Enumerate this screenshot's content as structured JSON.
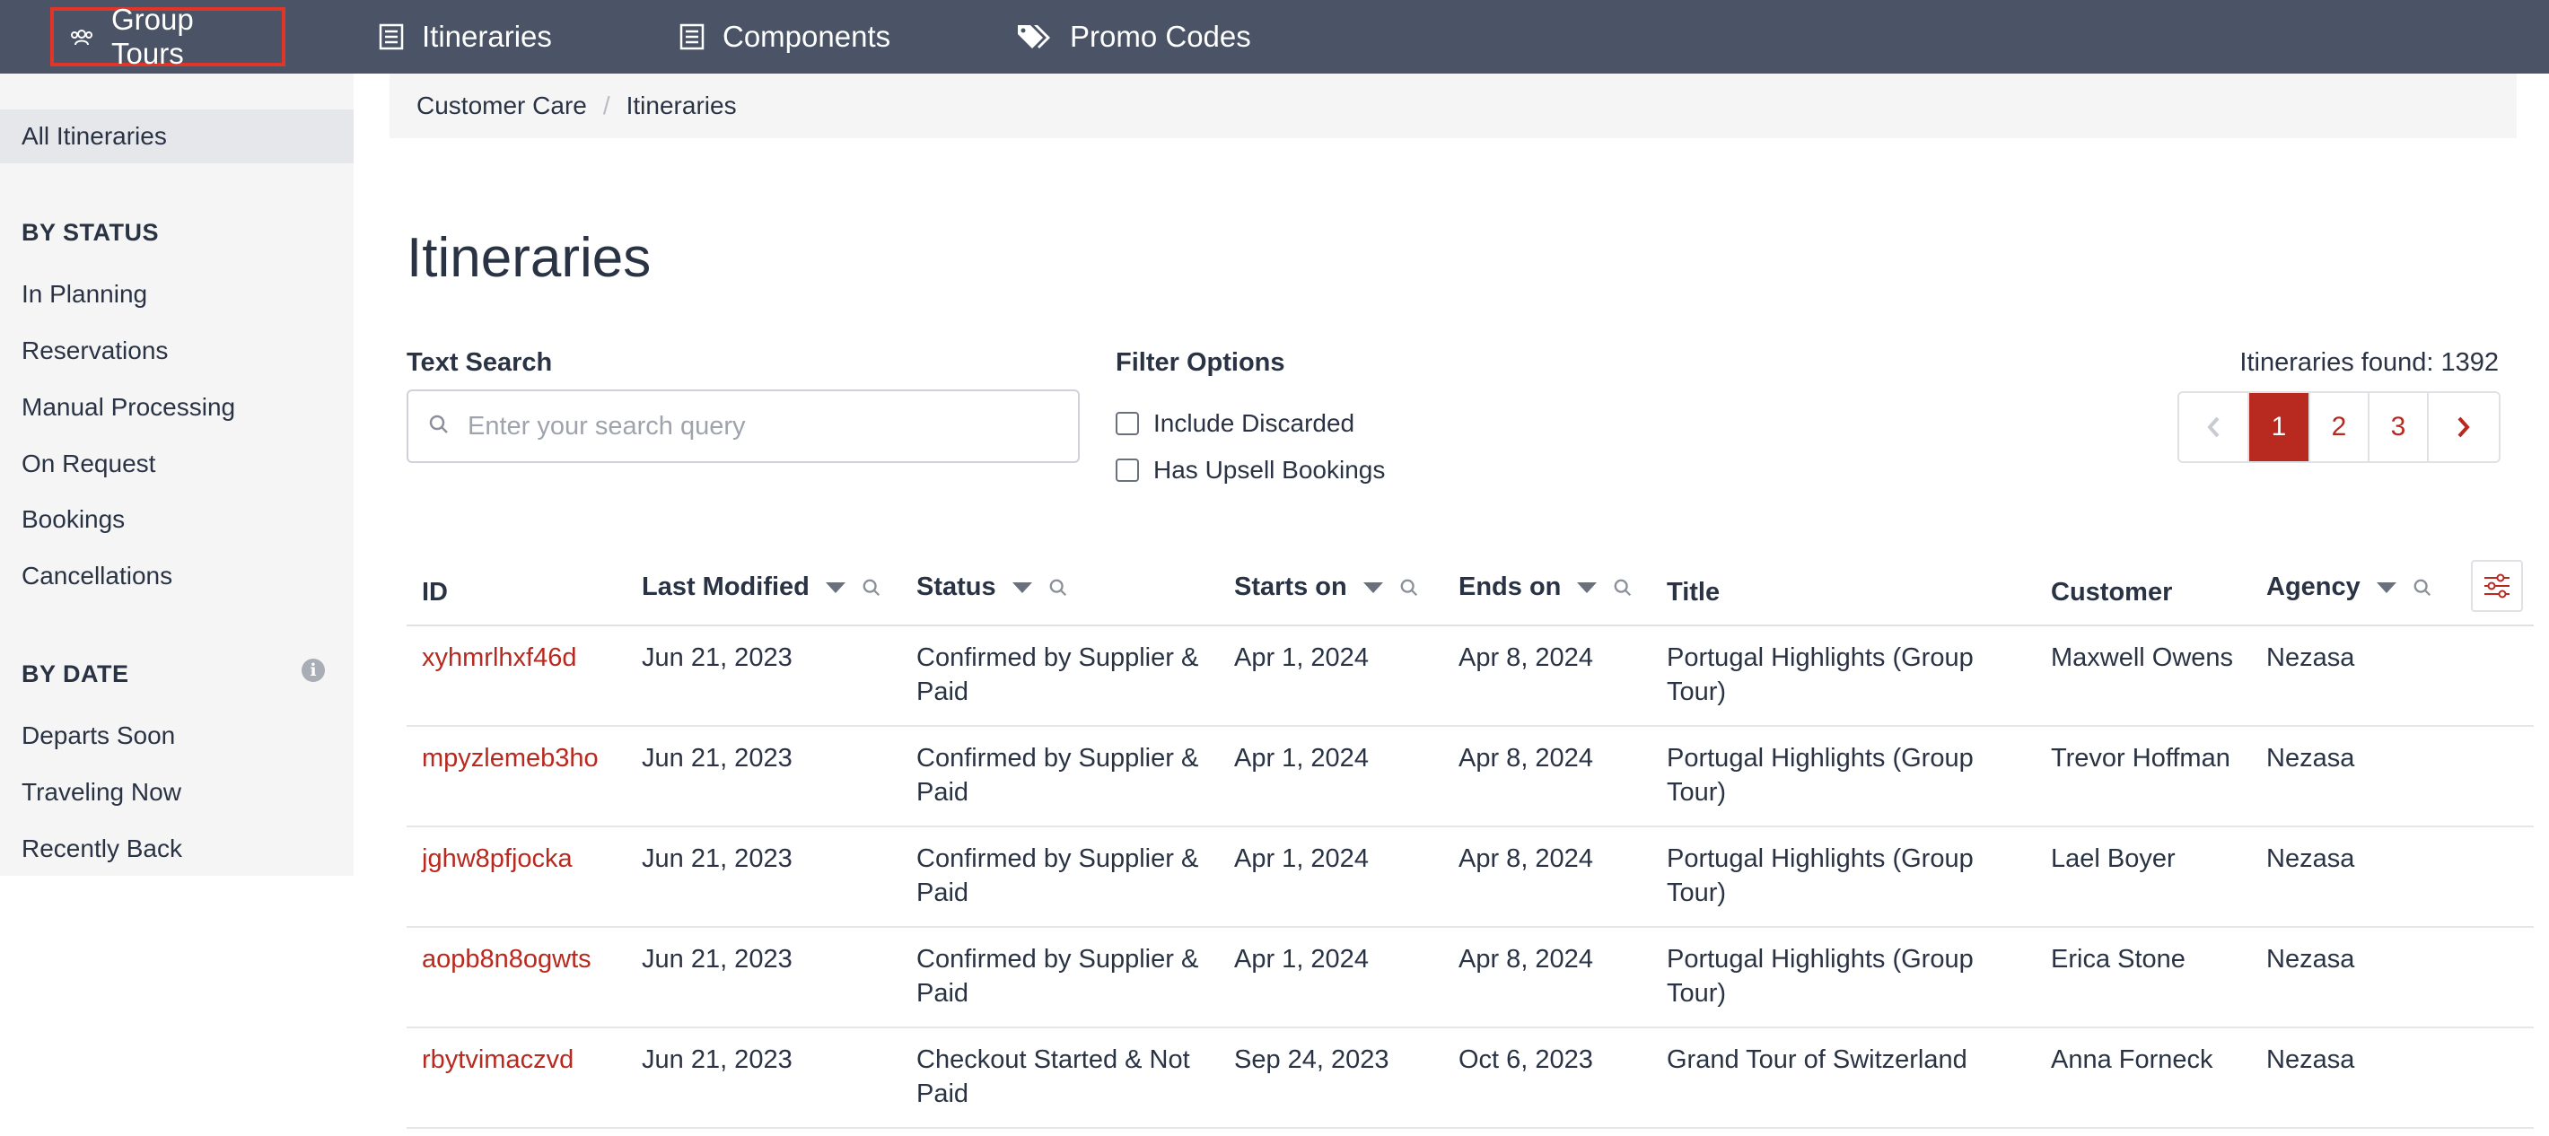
{
  "nav": {
    "items": [
      {
        "label": "Group Tours",
        "icon": "group-icon",
        "active": true
      },
      {
        "label": "Itineraries",
        "icon": "list-icon"
      },
      {
        "label": "Components",
        "icon": "list-icon"
      },
      {
        "label": "Promo Codes",
        "icon": "tags-icon"
      }
    ]
  },
  "sidebar": {
    "all": "All Itineraries",
    "by_status_heading": "BY STATUS",
    "status_items": [
      "In Planning",
      "Reservations",
      "Manual Processing",
      "On Request",
      "Bookings",
      "Cancellations"
    ],
    "by_date_heading": "BY DATE",
    "date_items": [
      "Departs Soon",
      "Traveling Now",
      "Recently Back"
    ]
  },
  "breadcrumb": [
    "Customer Care",
    "Itineraries"
  ],
  "page_title": "Itineraries",
  "search": {
    "label": "Text Search",
    "placeholder": "Enter your search query",
    "value": ""
  },
  "filters": {
    "label": "Filter Options",
    "options": [
      {
        "label": "Include Discarded",
        "checked": false
      },
      {
        "label": "Has Upsell Bookings",
        "checked": false
      }
    ]
  },
  "results": {
    "found_text": "Itineraries found: 1392"
  },
  "pagination": {
    "pages": [
      "1",
      "2",
      "3"
    ],
    "current": "1"
  },
  "table": {
    "columns": [
      "ID",
      "Last Modified",
      "Status",
      "Starts on",
      "Ends on",
      "Title",
      "Customer",
      "Agency"
    ],
    "rows": [
      {
        "id": "xyhmrlhxf46d",
        "modified": "Jun 21, 2023",
        "status1": "Confirmed by Supplier &",
        "status2": "Paid",
        "start": "Apr 1, 2024",
        "end": "Apr 8, 2024",
        "title1": "Portugal Highlights (Group",
        "title2": "Tour)",
        "customer": "Maxwell Owens",
        "agency": "Nezasa"
      },
      {
        "id": "mpyzlemeb3ho",
        "modified": "Jun 21, 2023",
        "status1": "Confirmed by Supplier &",
        "status2": "Paid",
        "start": "Apr 1, 2024",
        "end": "Apr 8, 2024",
        "title1": "Portugal Highlights (Group",
        "title2": "Tour)",
        "customer": "Trevor Hoffman",
        "agency": "Nezasa"
      },
      {
        "id": "jghw8pfjocka",
        "modified": "Jun 21, 2023",
        "status1": "Confirmed by Supplier &",
        "status2": "Paid",
        "start": "Apr 1, 2024",
        "end": "Apr 8, 2024",
        "title1": "Portugal Highlights (Group",
        "title2": "Tour)",
        "customer": "Lael Boyer",
        "agency": "Nezasa"
      },
      {
        "id": "aopb8n8ogwts",
        "modified": "Jun 21, 2023",
        "status1": "Confirmed by Supplier &",
        "status2": "Paid",
        "start": "Apr 1, 2024",
        "end": "Apr 8, 2024",
        "title1": "Portugal Highlights (Group",
        "title2": "Tour)",
        "customer": "Erica Stone",
        "agency": "Nezasa"
      },
      {
        "id": "rbytvimaczvd",
        "modified": "Jun 21, 2023",
        "status1": "Checkout Started & Not",
        "status2": "Paid",
        "start": "Sep 24, 2023",
        "end": "Oct 6, 2023",
        "title1": "Grand Tour of Switzerland",
        "title2": "",
        "customer": "Anna Forneck",
        "agency": "Nezasa"
      }
    ]
  },
  "colors": {
    "nav_bg": "#4a5466",
    "accent": "#b8291f",
    "active_outline": "#e0362a",
    "sidebar_bg": "#f5f5f6"
  }
}
